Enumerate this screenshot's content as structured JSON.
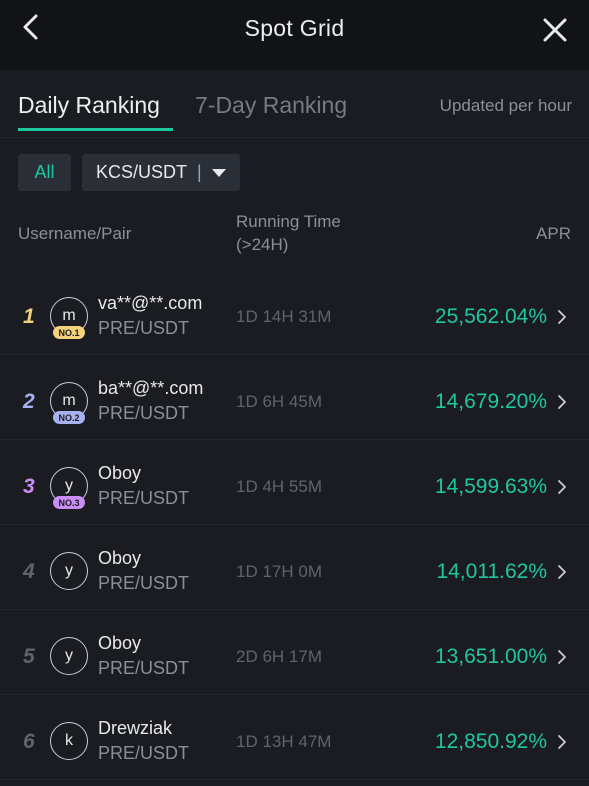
{
  "header": {
    "title": "Spot Grid"
  },
  "tabs": {
    "daily": "Daily Ranking",
    "seven_day": "7-Day Ranking",
    "updated": "Updated per hour"
  },
  "filters": {
    "all": "All",
    "pair": "KCS/USDT",
    "pair_sep": "|"
  },
  "columns": {
    "user": "Username/Pair",
    "time_line1": "Running Time",
    "time_line2": "(>24H)",
    "apr": "APR"
  },
  "colors": {
    "accent": "#1fc7a0",
    "rank1": "#f2d27a",
    "rank2": "#a9b2f0",
    "rank3": "#c98ef5",
    "rank_other": "#5f636b"
  },
  "rows": [
    {
      "rank": "1",
      "avatar": "m",
      "badge": "NO.1",
      "name": "va**@**.com",
      "pair": "PRE/USDT",
      "time": "1D 14H 31M",
      "apr": "25,562.04%"
    },
    {
      "rank": "2",
      "avatar": "m",
      "badge": "NO.2",
      "name": "ba**@**.com",
      "pair": "PRE/USDT",
      "time": "1D 6H 45M",
      "apr": "14,679.20%"
    },
    {
      "rank": "3",
      "avatar": "y",
      "badge": "NO.3",
      "name": "Oboy",
      "pair": "PRE/USDT",
      "time": "1D 4H 55M",
      "apr": "14,599.63%"
    },
    {
      "rank": "4",
      "avatar": "y",
      "badge": "",
      "name": "Oboy",
      "pair": "PRE/USDT",
      "time": "1D 17H 0M",
      "apr": "14,011.62%"
    },
    {
      "rank": "5",
      "avatar": "y",
      "badge": "",
      "name": "Oboy",
      "pair": "PRE/USDT",
      "time": "2D 6H 17M",
      "apr": "13,651.00%"
    },
    {
      "rank": "6",
      "avatar": "k",
      "badge": "",
      "name": "Drewziak",
      "pair": "PRE/USDT",
      "time": "1D 13H 47M",
      "apr": "12,850.92%"
    }
  ]
}
